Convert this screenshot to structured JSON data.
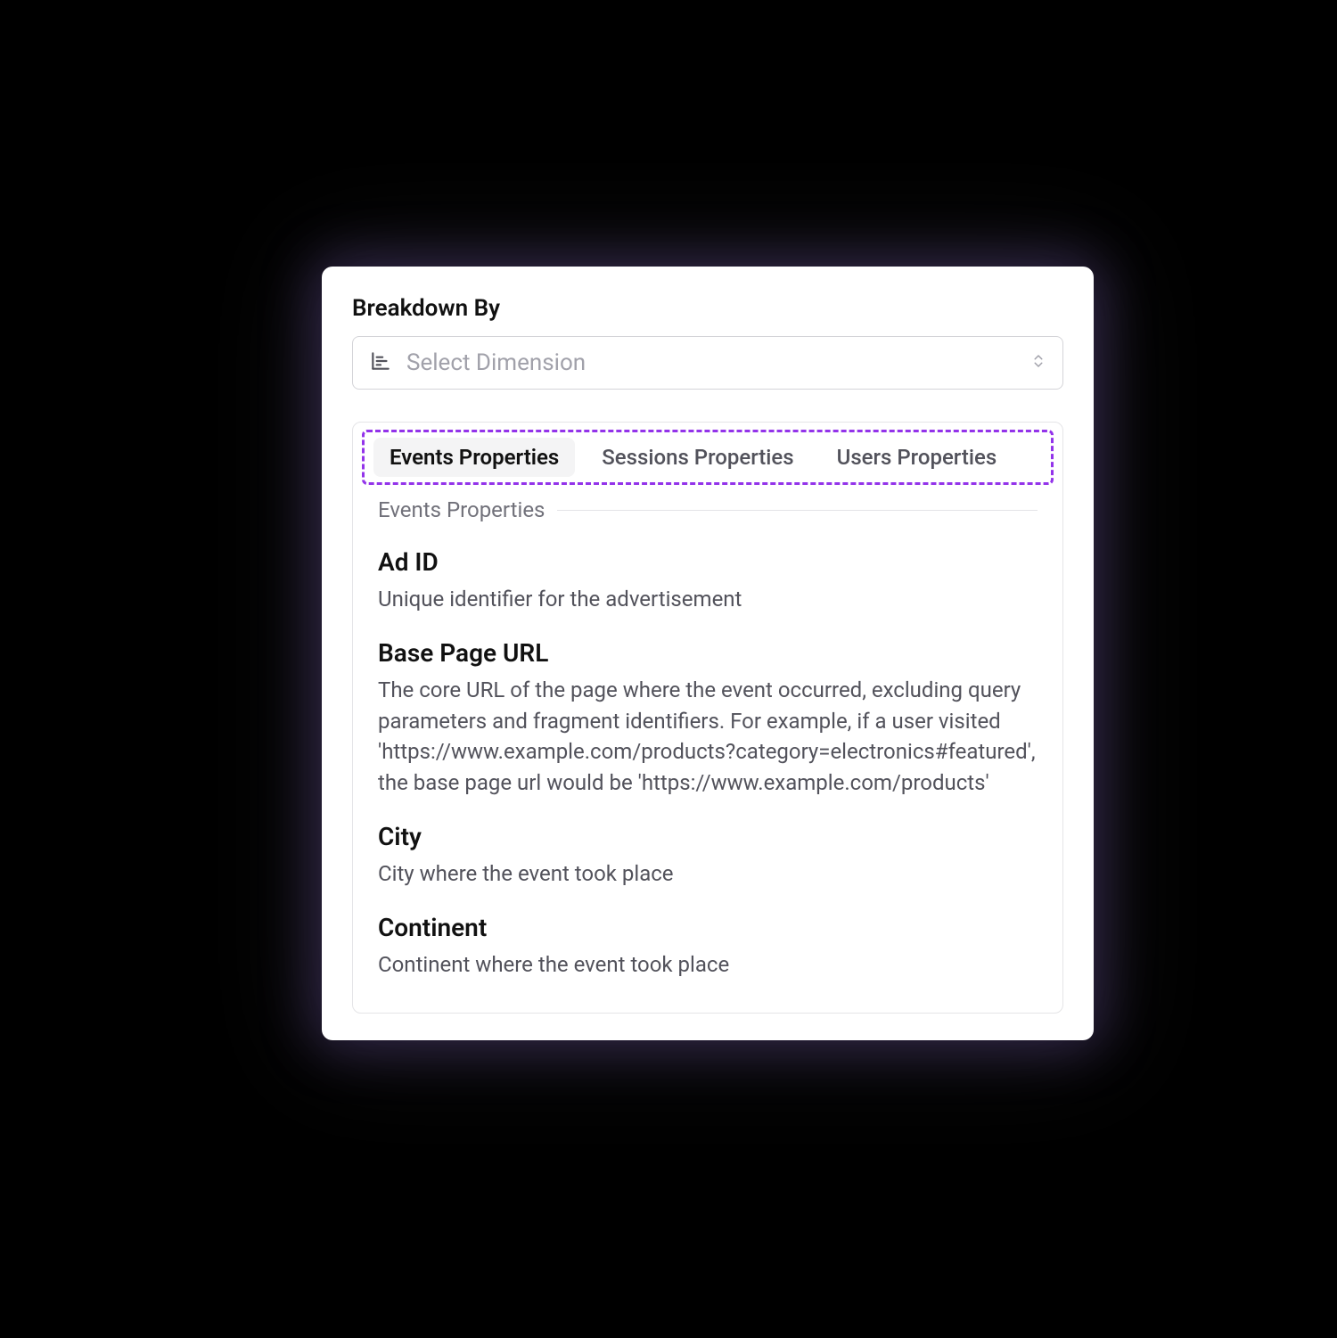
{
  "header": {
    "title": "Breakdown By"
  },
  "select": {
    "placeholder": "Select Dimension"
  },
  "tabs": {
    "items": [
      {
        "label": "Events Properties",
        "active": true
      },
      {
        "label": "Sessions Properties",
        "active": false
      },
      {
        "label": "Users Properties",
        "active": false
      }
    ]
  },
  "section": {
    "label": "Events Properties"
  },
  "properties": [
    {
      "name": "Ad ID",
      "description": "Unique identifier for the advertisement"
    },
    {
      "name": "Base Page URL",
      "description": "The core URL of the page where the event occurred, excluding query parameters and fragment identifiers. For example, if a user visited 'https://www.example.com/products?category=electronics#featured', the base page url would be 'https://www.example.com/products'"
    },
    {
      "name": "City",
      "description": "City where the event took place"
    },
    {
      "name": "Continent",
      "description": "Continent where the event took place"
    }
  ],
  "highlight_color": "#9333ea"
}
